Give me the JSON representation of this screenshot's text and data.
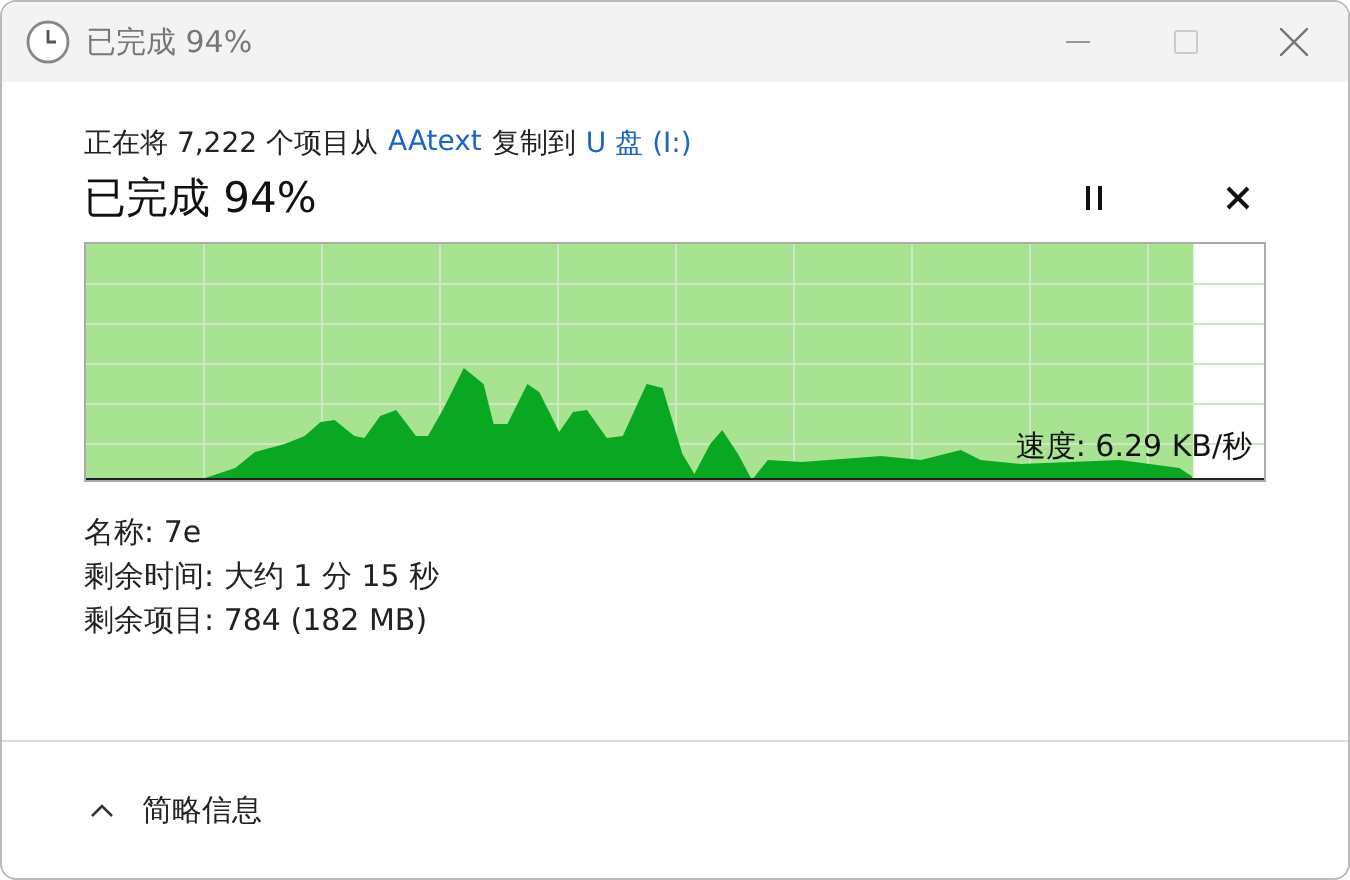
{
  "window": {
    "title": "已完成 94%"
  },
  "copy_line": {
    "prefix": "正在将 7,222 个项目从",
    "source": "AAtext",
    "middle": "复制到",
    "destination": "U 盘 (I:)"
  },
  "progress": {
    "heading": "已完成 94%",
    "level": 0.94,
    "speed": "速度: 6.29 KB/秒"
  },
  "details": [
    {
      "label": "名称:",
      "value": "7e"
    },
    {
      "label": "剩余时间:",
      "value": "大约 1 分 15 秒"
    },
    {
      "label": "剩余项目:",
      "value": "784 (182 MB)"
    }
  ],
  "footer": {
    "toggle": "简略信息",
    "expanded": true
  }
}
